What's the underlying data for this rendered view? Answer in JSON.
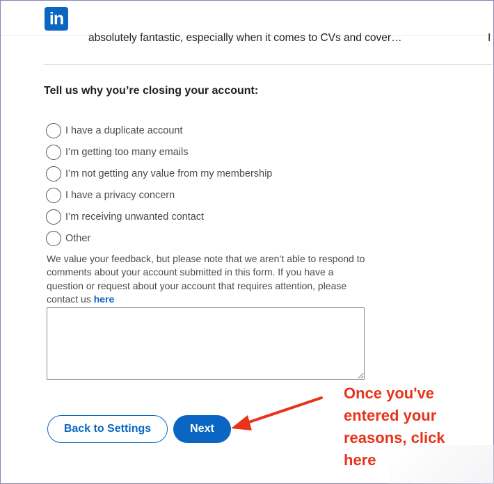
{
  "header": {
    "logo_text": "in",
    "brand_color": "#0a66c2"
  },
  "snippet": {
    "text": "absolutely fantastic, especially when it comes to CVs and cover…",
    "right_fragment": "I"
  },
  "form": {
    "question": "Tell us why you’re closing your account:",
    "options": [
      {
        "label": "I have a duplicate account",
        "selected": false
      },
      {
        "label": "I’m getting too many emails",
        "selected": false
      },
      {
        "label": "I’m not getting any value from my membership",
        "selected": false
      },
      {
        "label": "I have a privacy concern",
        "selected": false
      },
      {
        "label": "I’m receiving unwanted contact",
        "selected": false
      },
      {
        "label": "Other",
        "selected": false
      }
    ],
    "notice_text": "We value your feedback, but please note that we aren’t able to respond to comments about your account submitted in this form. If you have a question or request about your account that requires attention, please contact us",
    "notice_link": "here",
    "feedback_value": ""
  },
  "buttons": {
    "back_label": "Back to Settings",
    "next_label": "Next"
  },
  "annotation": {
    "lines": [
      "Once you've",
      "entered your",
      "reasons, click",
      "here"
    ],
    "color": "#e8331a"
  }
}
